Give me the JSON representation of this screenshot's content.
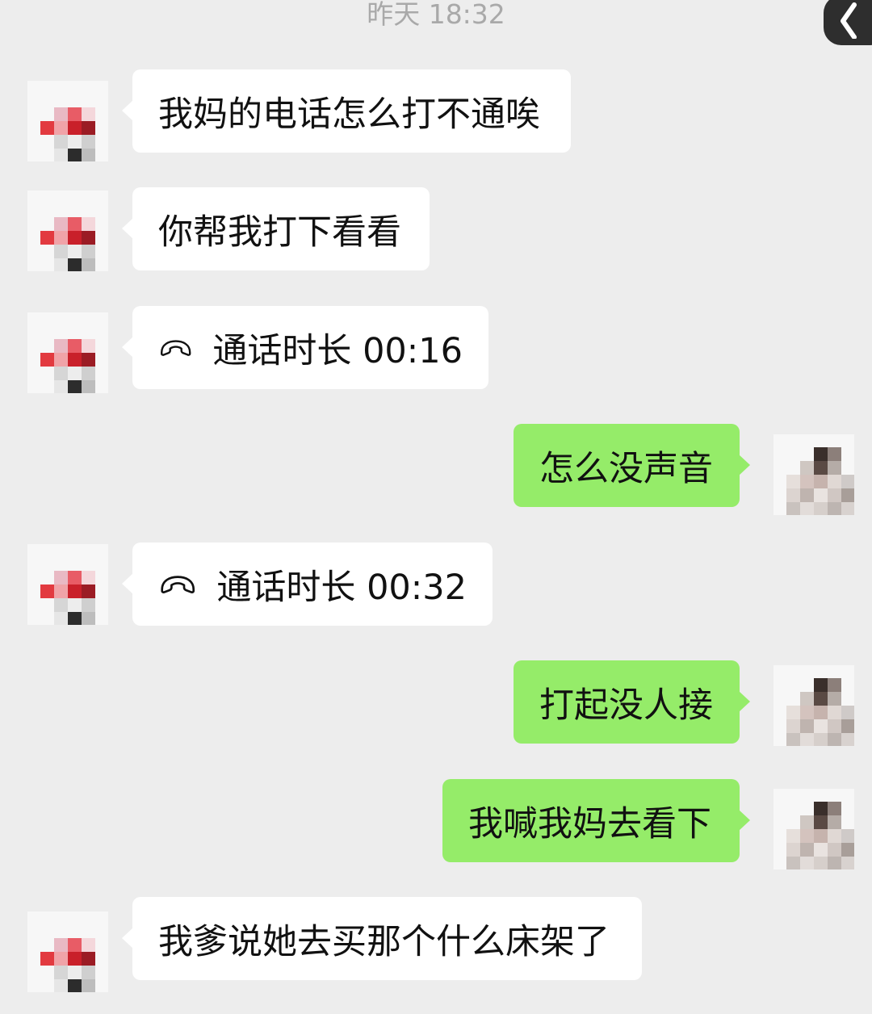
{
  "header": {
    "timestamp": "昨天 18:32",
    "back_icon": "chevron-left-icon"
  },
  "messages": [
    {
      "side": "left",
      "type": "text",
      "text": "我妈的电话怎么打不通唉"
    },
    {
      "side": "left",
      "type": "text",
      "text": "你帮我打下看看"
    },
    {
      "side": "left",
      "type": "call",
      "icon": "phone-hangup-icon",
      "text": "通话时长 00:16"
    },
    {
      "side": "right",
      "type": "text",
      "text": "怎么没声音"
    },
    {
      "side": "left",
      "type": "call",
      "icon": "phone-hangup-icon",
      "text": "通话时长 00:32"
    },
    {
      "side": "right",
      "type": "text",
      "text": "打起没人接"
    },
    {
      "side": "right",
      "type": "text",
      "text": "我喊我妈去看下"
    },
    {
      "side": "left",
      "type": "text",
      "text": "我爹说她去买那个什么床架了"
    }
  ],
  "colors": {
    "background": "#ededed",
    "incoming_bubble": "#ffffff",
    "outgoing_bubble": "#95ec69",
    "timestamp_text": "#a9a9a9"
  },
  "avatars": {
    "contact": "pixelated-avatar",
    "self": "pixelated-avatar"
  }
}
